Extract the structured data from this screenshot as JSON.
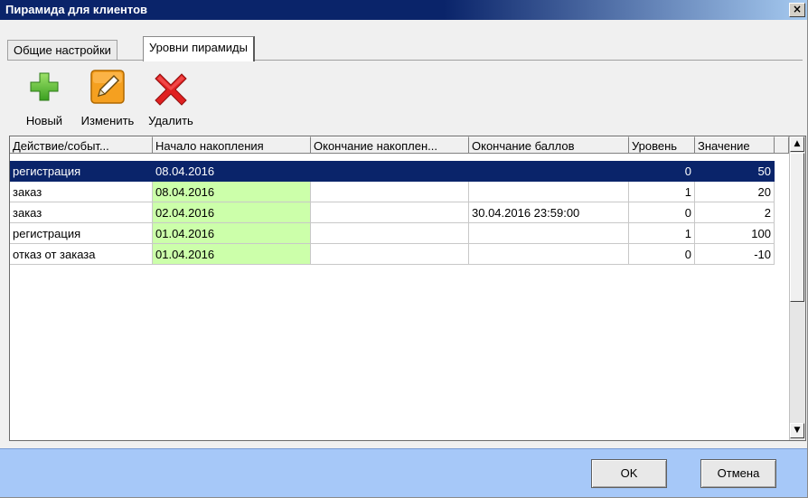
{
  "window": {
    "title": "Пирамида для клиентов",
    "close_glyph": "×"
  },
  "tabs": [
    {
      "label": "Общие настройки",
      "active": false
    },
    {
      "label": "Уровни пирамиды",
      "active": true
    }
  ],
  "toolbar": {
    "new_label": "Новый",
    "new_icon": "plus-icon",
    "edit_label": "Изменить",
    "edit_icon": "pencil-icon",
    "delete_label": "Удалить",
    "delete_icon": "red-x-icon"
  },
  "grid": {
    "columns": [
      "Действие/событ...",
      "Начало накопления",
      "Окончание накоплен...",
      "Окончание баллов",
      "Уровень",
      "Значение"
    ],
    "rows": [
      {
        "action": "регистрация",
        "start": "08.04.2016",
        "end": "",
        "points_end": "",
        "level": "0",
        "value": "50",
        "selected": true
      },
      {
        "action": "заказ",
        "start": "08.04.2016",
        "end": "",
        "points_end": "",
        "level": "1",
        "value": "20",
        "selected": false
      },
      {
        "action": "заказ",
        "start": "02.04.2016",
        "end": "",
        "points_end": "30.04.2016 23:59:00",
        "level": "0",
        "value": "2",
        "selected": false
      },
      {
        "action": "регистрация",
        "start": "01.04.2016",
        "end": "",
        "points_end": "",
        "level": "1",
        "value": "100",
        "selected": false
      },
      {
        "action": "отказ от заказа",
        "start": "01.04.2016",
        "end": "",
        "points_end": "",
        "level": "0",
        "value": "-10",
        "selected": false
      }
    ],
    "scroll_up_glyph": "▲",
    "scroll_down_glyph": "▼"
  },
  "footer": {
    "ok_label": "OK",
    "cancel_label": "Отмена"
  },
  "colors": {
    "title_bar": "#0a246a",
    "selection": "#0a246a",
    "start_column": "#ccffaa",
    "footer": "#a6c8f8"
  }
}
